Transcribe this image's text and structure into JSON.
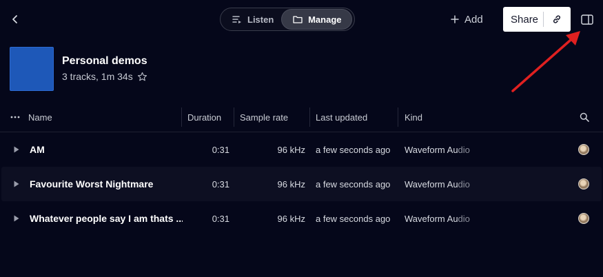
{
  "topbar": {
    "listen_label": "Listen",
    "manage_label": "Manage",
    "add_label": "Add",
    "share_label": "Share"
  },
  "playlist": {
    "title": "Personal demos",
    "meta": "3 tracks, 1m 34s",
    "cover_color": "#1e58b8"
  },
  "columns": {
    "name": "Name",
    "duration": "Duration",
    "sample_rate": "Sample rate",
    "last_updated": "Last updated",
    "kind": "Kind"
  },
  "tracks": [
    {
      "name": "AM",
      "duration": "0:31",
      "sample_rate": "96 kHz",
      "last_updated": "a few seconds ago",
      "kind_a": "Waveform Au",
      "kind_b": "dio"
    },
    {
      "name": "Favourite Worst Nightmare",
      "duration": "0:31",
      "sample_rate": "96 kHz",
      "last_updated": "a few seconds ago",
      "kind_a": "Waveform Au",
      "kind_b": "dio"
    },
    {
      "name": "Whatever people say I am thats ...",
      "duration": "0:31",
      "sample_rate": "96 kHz",
      "last_updated": "a few seconds ago",
      "kind_a": "Waveform Au",
      "kind_b": "dio"
    }
  ],
  "icons": {
    "back": "chevron-left-icon",
    "listen": "queue-icon",
    "manage": "folder-icon",
    "add": "plus-icon",
    "link": "link-icon",
    "panel": "sidebar-panel-icon",
    "star": "star-outline-icon",
    "more": "more-horizontal-icon",
    "search": "search-icon",
    "play": "play-icon",
    "annotation": "red-arrow-annotation"
  },
  "colors": {
    "background": "#05071a",
    "accent_annotation": "#e02020",
    "share_bg": "#ffffff"
  }
}
